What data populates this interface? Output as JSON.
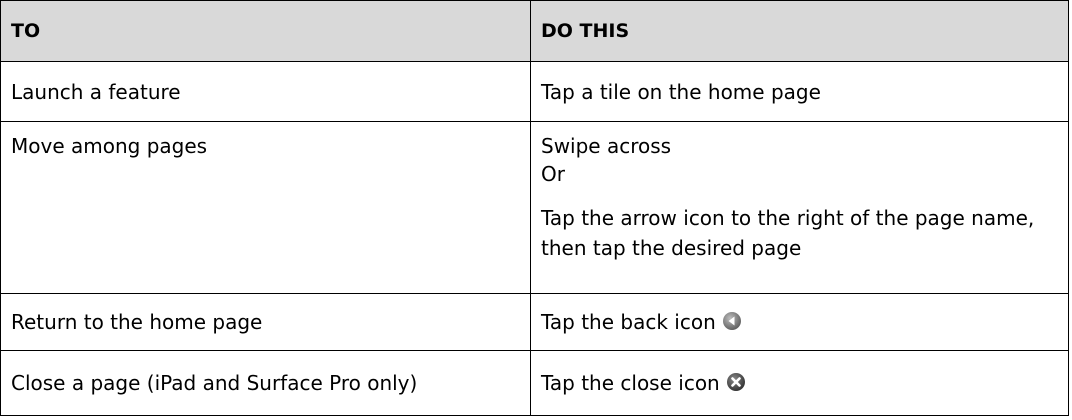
{
  "table": {
    "headers": {
      "to": "TO",
      "do_this": "DO THIS"
    },
    "rows": [
      {
        "to": "Launch a feature",
        "do_this": "Tap a tile on the home page"
      },
      {
        "to": "Move among pages",
        "do_this_line1": "Swipe across",
        "do_this_line2": "Or",
        "do_this_line3": "Tap the arrow icon to the right of the page name, then tap the desired page"
      },
      {
        "to": "Return to the home page",
        "do_this": "Tap the back icon",
        "icon": "back-arrow-circle-icon"
      },
      {
        "to": "Close a page (iPad and Surface Pro only)",
        "do_this": "Tap the close icon",
        "icon": "close-x-circle-icon"
      }
    ]
  },
  "colors": {
    "header_background": "#d9d9d9",
    "border": "#000000",
    "icon_fill": "#6e6e6e"
  }
}
